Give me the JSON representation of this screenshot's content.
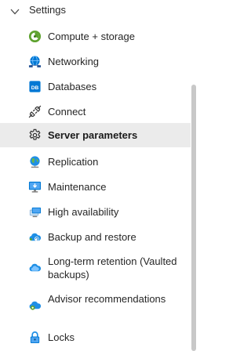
{
  "settings": {
    "header_label": "Settings",
    "items": [
      {
        "label": "Compute + storage",
        "icon": "compute-storage-icon"
      },
      {
        "label": "Networking",
        "icon": "networking-icon"
      },
      {
        "label": "Databases",
        "icon": "databases-icon",
        "icon_text": "DB"
      },
      {
        "label": "Connect",
        "icon": "plug-icon"
      },
      {
        "label": "Server parameters",
        "icon": "gear-icon",
        "selected": true
      },
      {
        "label": "Replication",
        "icon": "globe-icon"
      },
      {
        "label": "Maintenance",
        "icon": "maintenance-icon"
      },
      {
        "label": "High availability",
        "icon": "high-availability-icon"
      },
      {
        "label": "Backup and restore",
        "icon": "cloud-backup-icon"
      },
      {
        "label": "Long-term retention (Vaulted backups)",
        "icon": "cloud-vault-icon"
      },
      {
        "label": "Advisor recommendations",
        "icon": "advisor-cloud-icon"
      },
      {
        "label": "Locks",
        "icon": "lock-icon"
      }
    ]
  },
  "colors": {
    "selected_background": "#ebebeb",
    "azure_blue": "#0078d4",
    "compute_green": "#5ea22f",
    "scrollbar": "#c8c8c8"
  }
}
